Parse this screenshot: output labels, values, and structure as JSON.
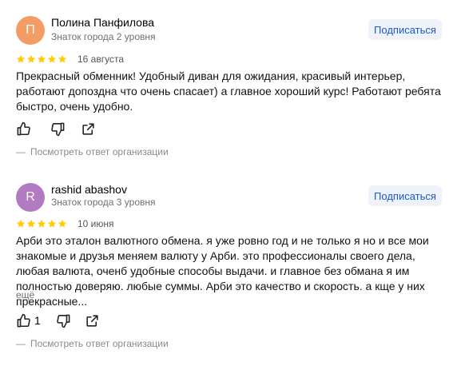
{
  "reviews": [
    {
      "avatar_letter": "П",
      "avatar_color": "#f39c63",
      "name": "Полина Панфилова",
      "level": "Знаток города 2 уровня",
      "subscribe": "Подписаться",
      "rating": 5,
      "date": "16 августа",
      "text": "Прекрасный обменник! Удобный диван для ожидания, красивый интерьер, работают допоздна что очень спасает) а главное хороший курс! Работают ребята быстро, очень удобно.",
      "likes": "",
      "org_reply": "Посмотреть ответ организации"
    },
    {
      "avatar_letter": "R",
      "avatar_color": "#b27ac0",
      "name": "rashid abashov",
      "level": "Знаток города 3 уровня",
      "subscribe": "Подписаться",
      "rating": 5,
      "date": "10 июня",
      "text": "Арби это эталон валютного обмена. я уже ровно год и не только я но и все мои знакомые и друзья меняем валюту у Арби. это профессионалы своего дела, любая валюта, оченб удобные способы выдачи. и главное без обмана я им полностью доверяю. любые суммы. Арби это качество и скорость. а кще у них прекрасные...",
      "more": "ещё",
      "likes": "1",
      "org_reply": "Посмотреть ответ организации"
    }
  ],
  "colors": {
    "star": "#fc0",
    "link": "#1b59c6",
    "button_bg": "#eef2fb",
    "muted": "#6f6f6f"
  },
  "icons": [
    "thumb-up-icon",
    "thumb-down-icon",
    "share-icon",
    "star-icon"
  ]
}
